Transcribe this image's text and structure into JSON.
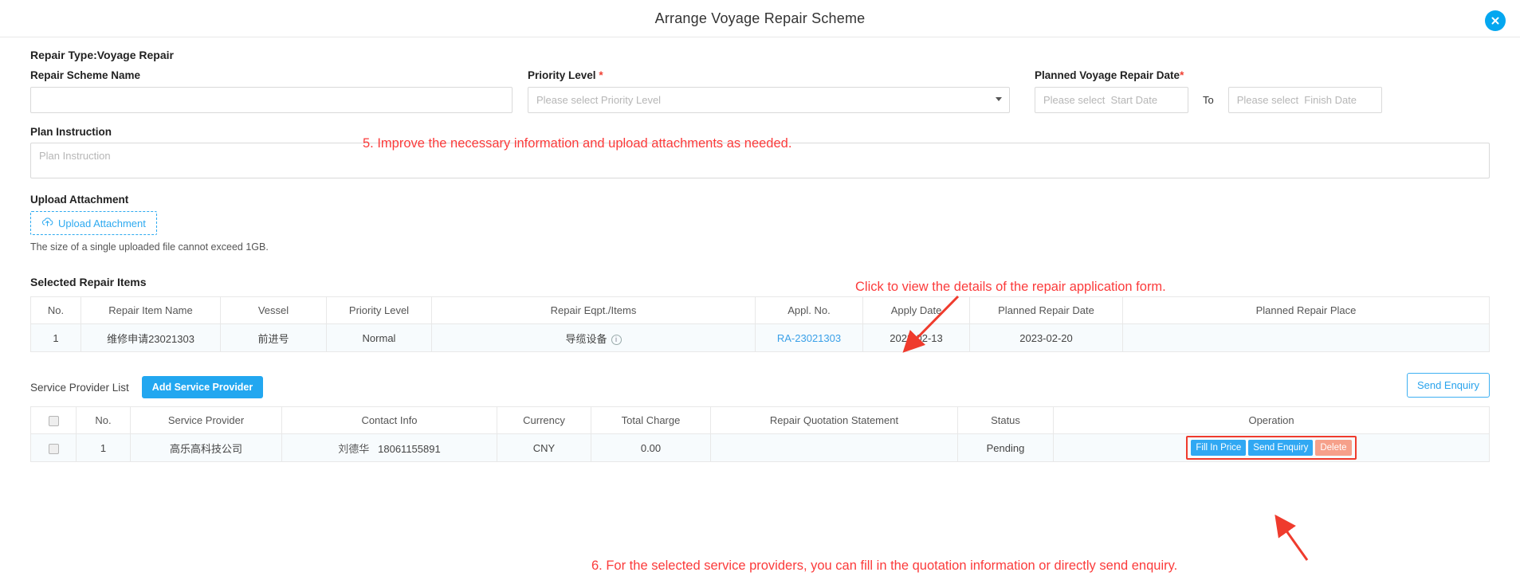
{
  "header": {
    "title": "Arrange Voyage Repair Scheme",
    "close_icon": "close-icon"
  },
  "form": {
    "repair_type": "Repair Type:Voyage Repair",
    "scheme_name": {
      "label": "Repair Scheme Name",
      "value": "",
      "placeholder": ""
    },
    "priority": {
      "label": "Priority Level",
      "required_mark": "*",
      "value": "",
      "placeholder": "Please select Priority Level",
      "caret_icon": "chevron-down-icon"
    },
    "planned_date": {
      "label": "Planned Voyage Repair Date",
      "required_mark": "*",
      "start_placeholder": "Please select  Start Date",
      "start_value": "",
      "separator": "To",
      "finish_placeholder": "Please select  Finish Date",
      "finish_value": ""
    },
    "plan_instruction": {
      "label": "Plan Instruction",
      "value": "",
      "placeholder": "Plan Instruction"
    },
    "upload": {
      "label": "Upload Attachment",
      "button_label": "Upload Attachment",
      "button_icon": "cloud-upload-icon",
      "hint": "The size of a single uploaded file cannot exceed 1GB."
    }
  },
  "repair_items": {
    "section_title": "Selected Repair Items",
    "columns": [
      "No.",
      "Repair Item Name",
      "Vessel",
      "Priority Level",
      "Repair Eqpt./Items",
      "Appl. No.",
      "Apply Date",
      "Planned Repair Date",
      "Planned Repair Place"
    ],
    "rows": [
      {
        "no": "1",
        "item_name": "维修申请23021303",
        "vessel": "前进号",
        "priority": "Normal",
        "eqpt": "导缆设备",
        "eqpt_icon": "info-circle-icon",
        "appl_no": "RA-23021303",
        "apply_date": "2023-02-13",
        "planned_repair_date": "2023-02-20",
        "planned_repair_place": ""
      }
    ]
  },
  "service_providers": {
    "list_label": "Service Provider List",
    "add_button": "Add Service Provider",
    "send_enquiry_button": "Send Enquiry",
    "columns": [
      "",
      "No.",
      "Service Provider",
      "Contact Info",
      "Currency",
      "Total Charge",
      "Repair Quotation Statement",
      "Status",
      "Operation"
    ],
    "rows": [
      {
        "no": "1",
        "provider": "高乐高科技公司",
        "contact_name": "刘德华",
        "contact_phone": "18061155891",
        "currency": "CNY",
        "total_charge": "0.00",
        "quotation_statement": "",
        "status": "Pending",
        "operations": {
          "fill_in_price": "Fill In Price",
          "send_enquiry": "Send Enquiry",
          "delete": "Delete"
        }
      }
    ]
  },
  "annotations": {
    "step5": "5. Improve the necessary information and upload attachments as needed.",
    "step_click_appl": "Click to view the details of the repair application form.",
    "step6": "6. For the selected service providers, you can fill in the quotation information or directly send enquiry."
  },
  "colors": {
    "accent": "#22a7f0",
    "annotation_red": "#fb3b3b",
    "required_red": "#f04134",
    "link_blue": "#3aa0e8",
    "delete_red": "#f6a08a"
  }
}
